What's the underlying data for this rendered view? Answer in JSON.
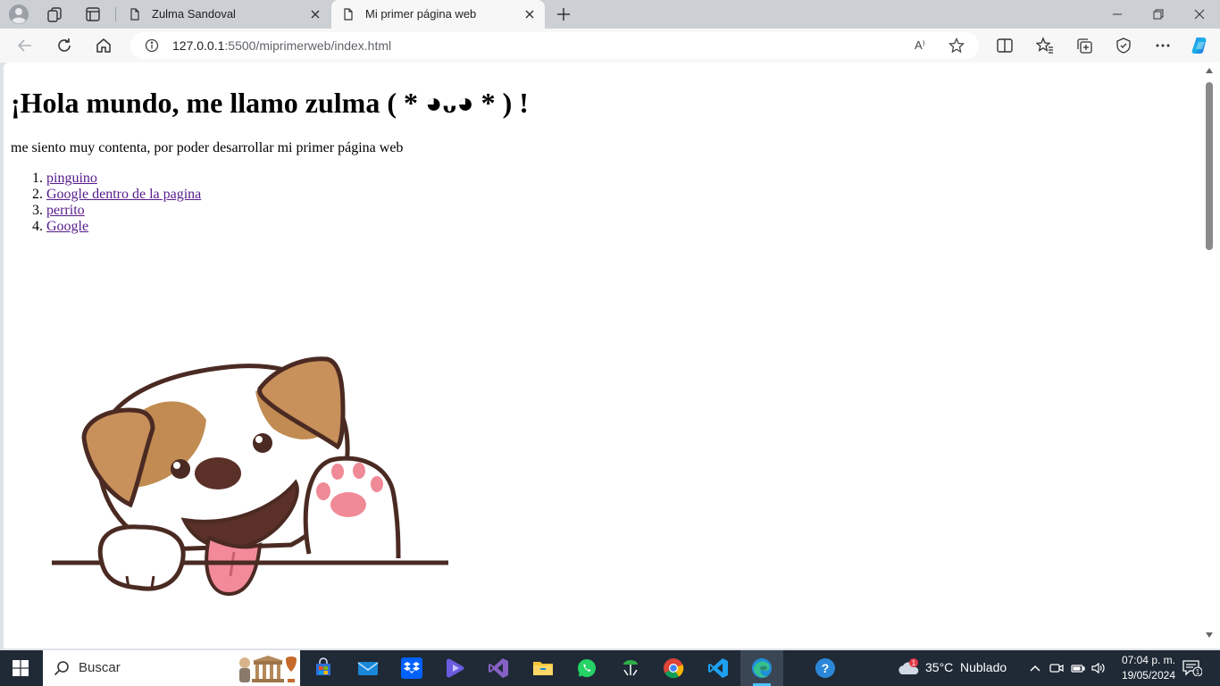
{
  "browser": {
    "tabs": [
      {
        "title": "Zulma Sandoval",
        "active": false
      },
      {
        "title": "Mi primer página web",
        "active": true
      }
    ],
    "address": {
      "host": "127.0.0.1",
      "rest": ":5500/miprimerweb/index.html"
    },
    "read_aloud_label": "A⁾"
  },
  "page": {
    "heading": "¡Hola mundo, me llamo zulma ( * ◕ᴗ◕ * ) !",
    "paragraph": "me siento muy contenta, por poder desarrollar mi primer página web",
    "links": [
      {
        "num": "1.",
        "text": "pinguino"
      },
      {
        "num": "2.",
        "text": "Google dentro de la pagina"
      },
      {
        "num": "3.",
        "text": "perrito"
      },
      {
        "num": "4.",
        "text": "Google"
      }
    ],
    "link_color": "#551a8b"
  },
  "taskbar": {
    "search_label": "Buscar",
    "weather": {
      "temp": "35°C",
      "condition": "Nublado",
      "badge": "1"
    },
    "clock": {
      "time": "07:04 p. m.",
      "date": "19/05/2024"
    },
    "notification_count": "1"
  },
  "colors": {
    "tabstrip": "#ccd0d5",
    "toolbar": "#f7f7f7",
    "taskbar": "#1f2a36",
    "edge_accent": "#4cc2ff"
  }
}
